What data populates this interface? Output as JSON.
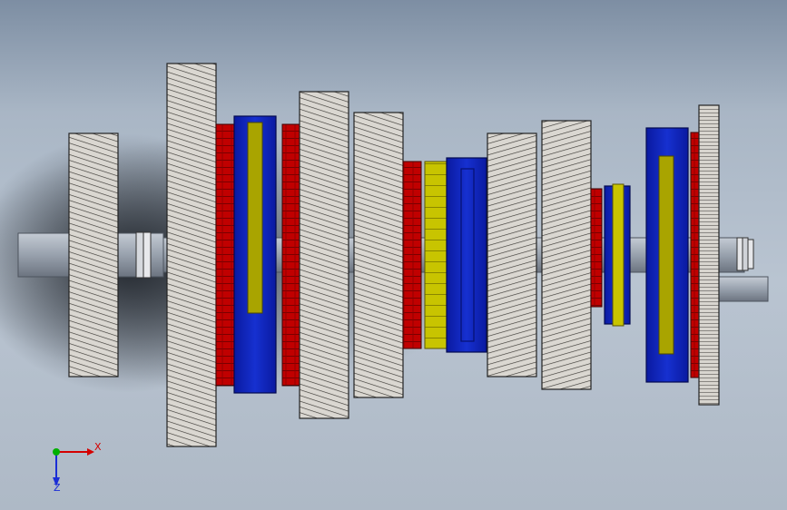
{
  "viewport": {
    "background_top": "#7d8ea3",
    "background_bottom": "#b9c4d1"
  },
  "colors": {
    "gear_light": "#d9d6d0",
    "gear_dark": "#3a3834",
    "shaft": "#9ea7b3",
    "shaft_dark": "#5f6772",
    "red_gear": "#c00000",
    "red_dark": "#6b0000",
    "blue_hub": "#0a1fb5",
    "blue_dark": "#061070",
    "yellow_sleeve": "#c8c400",
    "yellow_dark": "#6e6a00"
  },
  "triad": {
    "x_label": "X",
    "z_label": "Z",
    "x_color": "#d40000",
    "y_color": "#00b000",
    "z_color": "#1a2dd6"
  }
}
